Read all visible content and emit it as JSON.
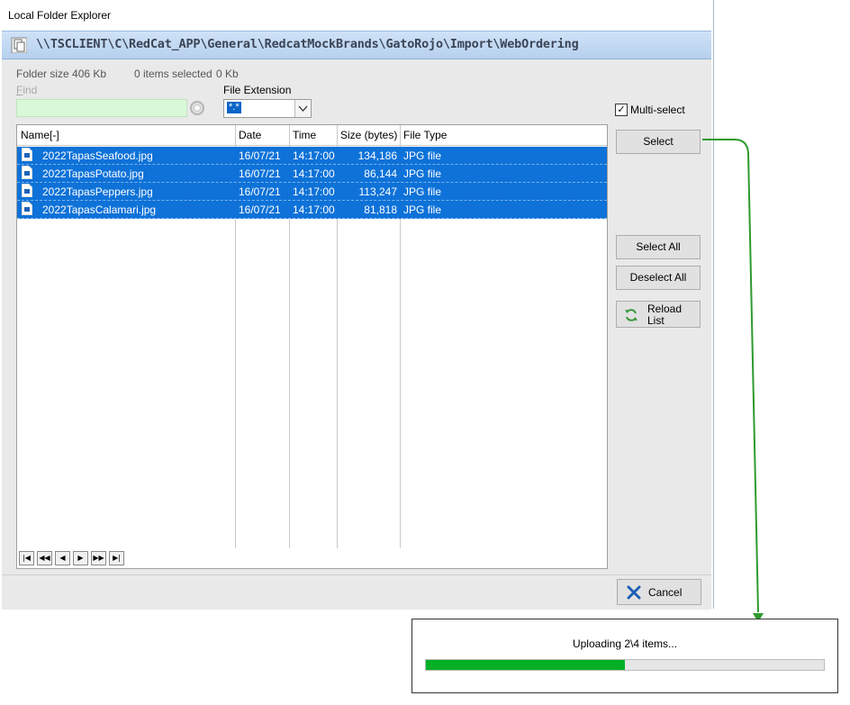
{
  "window": {
    "title": "Local Folder Explorer"
  },
  "path": "\\\\TSCLIENT\\C\\RedCat_APP\\General\\RedcatMockBrands\\GatoRojo\\Import\\WebOrdering",
  "stats": {
    "folder_size": "Folder size 406 Kb",
    "selected": "0 items selected",
    "selected_size": "0 Kb"
  },
  "find": {
    "label_first": "F",
    "label_rest": "ind",
    "value": ""
  },
  "extension": {
    "label": "File Extension",
    "value": "*.*"
  },
  "multiselect": {
    "label": "Multi-select",
    "checked": true
  },
  "table": {
    "columns": [
      "Name[-]",
      "Date",
      "Time",
      "Size (bytes)",
      "File Type"
    ],
    "rows": [
      {
        "name": "2022TapasSeafood.jpg",
        "date": "16/07/21",
        "time": "14:17:00",
        "size": "134,186",
        "type": "JPG file"
      },
      {
        "name": "2022TapasPotato.jpg",
        "date": "16/07/21",
        "time": "14:17:00",
        "size": "86,144",
        "type": "JPG file"
      },
      {
        "name": "2022TapasPeppers.jpg",
        "date": "16/07/21",
        "time": "14:17:00",
        "size": "113,247",
        "type": "JPG file"
      },
      {
        "name": "2022TapasCalamari.jpg",
        "date": "16/07/21",
        "time": "14:17:00",
        "size": "81,818",
        "type": "JPG file"
      }
    ]
  },
  "buttons": {
    "select": "Select",
    "select_all": "Select All",
    "deselect_all": "Deselect All",
    "reload_line1": "Reload",
    "reload_line2": "List",
    "cancel": "Cancel"
  },
  "upload": {
    "text": "Uploading 2\\4 items...",
    "progress": 0.5
  },
  "colors": {
    "selection": "#0e72d8",
    "progress": "#06b025",
    "arrow": "#2e9a2e"
  }
}
